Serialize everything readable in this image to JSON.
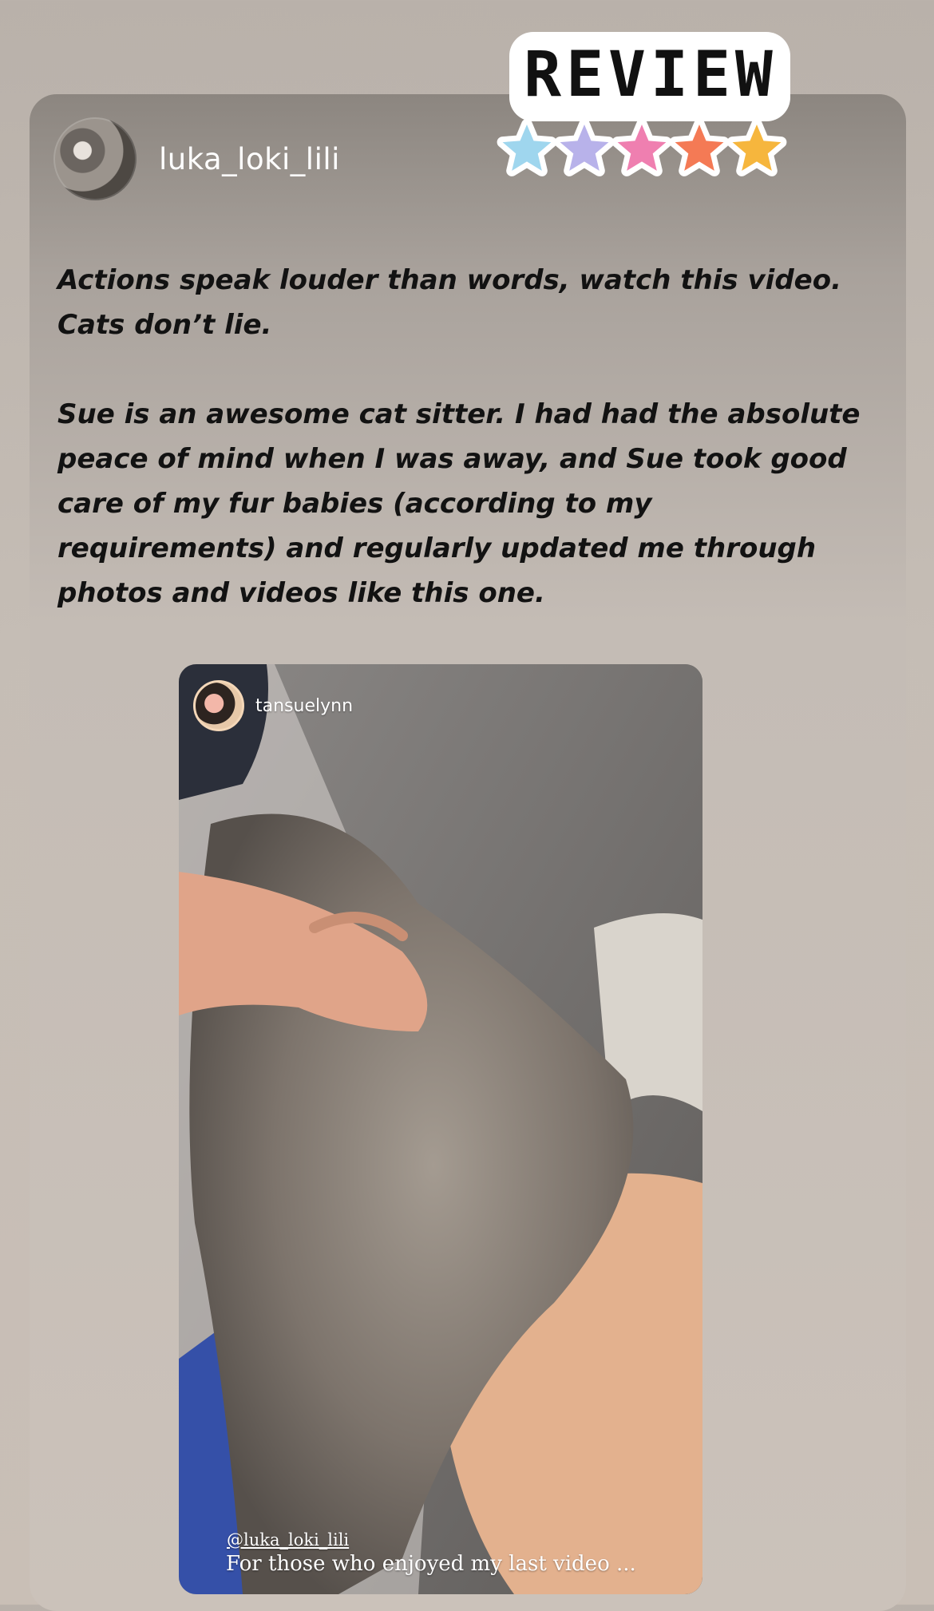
{
  "post": {
    "username": "luka_loki_lili",
    "paragraph1": "Actions speak louder than words, watch this video. Cats don’t lie.",
    "paragraph2": "Sue is an awesome cat sitter. I had had the absolute peace of mind when I was away, and Sue took good care of my fur babies (according to my requirements) and regularly updated me through photos and videos like this one."
  },
  "sticker": {
    "title": "REVIEW",
    "stars": [
      {
        "color": "#9fd6ee"
      },
      {
        "color": "#b8b2ea"
      },
      {
        "color": "#ef7fb0"
      },
      {
        "color": "#f47a55"
      },
      {
        "color": "#f6b63d"
      }
    ]
  },
  "video": {
    "username": "tansuelynn",
    "mention": "@luka_loki_lili",
    "caption": "For those who enjoyed my last video ..."
  }
}
